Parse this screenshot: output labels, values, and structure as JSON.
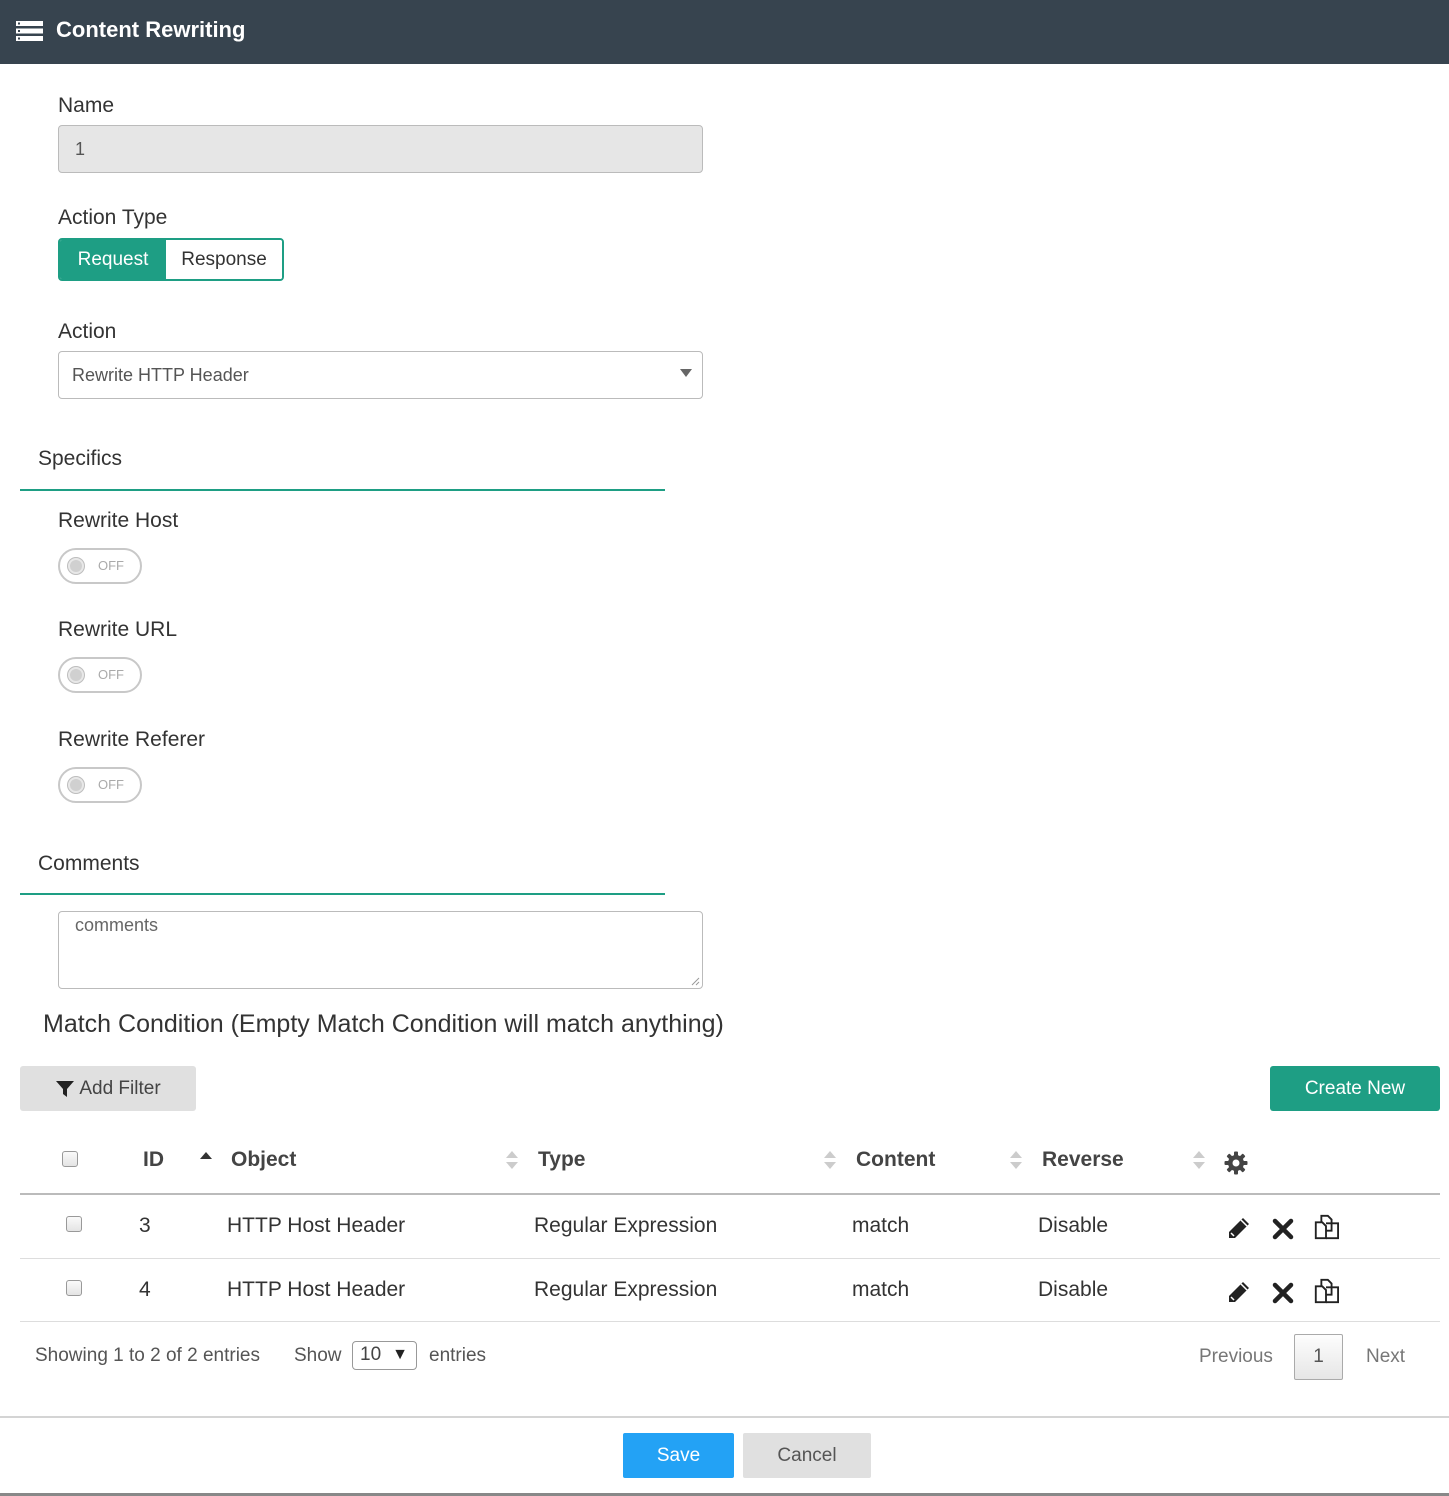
{
  "header": {
    "title": "Content Rewriting",
    "icon": "list-menu-icon"
  },
  "form": {
    "name_label": "Name",
    "name_value": "1",
    "action_type_label": "Action Type",
    "action_type_options": [
      "Request",
      "Response"
    ],
    "action_type_selected": "Request",
    "action_label": "Action",
    "action_value": "Rewrite HTTP Header"
  },
  "specifics": {
    "title": "Specifics",
    "toggles": [
      {
        "label": "Rewrite Host",
        "state": "OFF"
      },
      {
        "label": "Rewrite URL",
        "state": "OFF"
      },
      {
        "label": "Rewrite Referer",
        "state": "OFF"
      }
    ]
  },
  "comments": {
    "title": "Comments",
    "placeholder": "comments"
  },
  "match": {
    "title": "Match Condition (Empty Match Condition will match anything)",
    "add_filter_label": "Add Filter",
    "create_new_label": "Create New",
    "columns": [
      "ID",
      "Object",
      "Type",
      "Content",
      "Reverse"
    ],
    "rows": [
      {
        "id": "3",
        "object": "HTTP Host Header",
        "type": "Regular Expression",
        "content": "match",
        "reverse": "Disable"
      },
      {
        "id": "4",
        "object": "HTTP Host Header",
        "type": "Regular Expression",
        "content": "match",
        "reverse": "Disable"
      }
    ],
    "info": "Showing 1 to 2 of 2 entries",
    "show_label": "Show",
    "page_size": "10",
    "entries_label": "entries",
    "pager": {
      "previous": "Previous",
      "current": "1",
      "next": "Next"
    }
  },
  "footer": {
    "save_label": "Save",
    "cancel_label": "Cancel"
  },
  "colors": {
    "accent": "#1e9e84",
    "header_bg": "#37444f",
    "save_blue": "#23a2f5"
  }
}
